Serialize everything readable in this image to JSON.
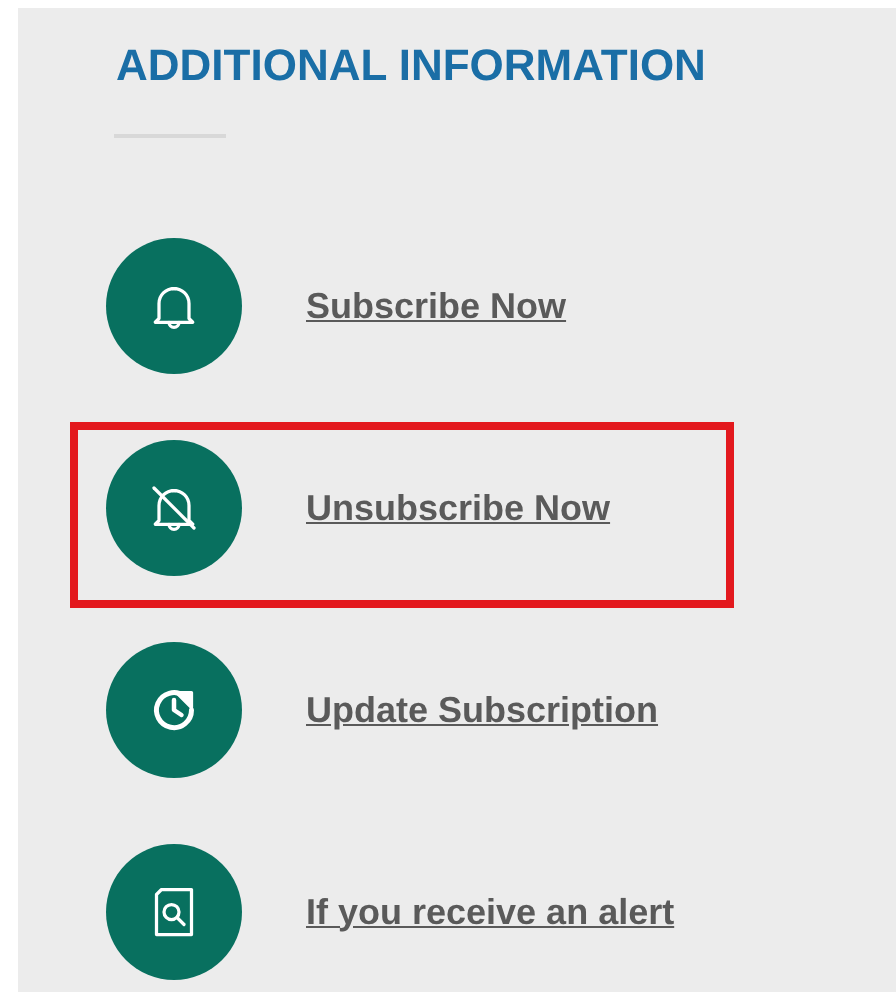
{
  "heading": "ADDITIONAL INFORMATION",
  "links": [
    {
      "kind": "bell",
      "label": "Subscribe Now",
      "highlighted": false
    },
    {
      "kind": "bell-off",
      "label": "Unsubscribe Now",
      "highlighted": true
    },
    {
      "kind": "refresh-clock",
      "label": "Update Subscription",
      "highlighted": false
    },
    {
      "kind": "doc-search",
      "label": "If you receive an alert",
      "highlighted": false
    }
  ]
}
